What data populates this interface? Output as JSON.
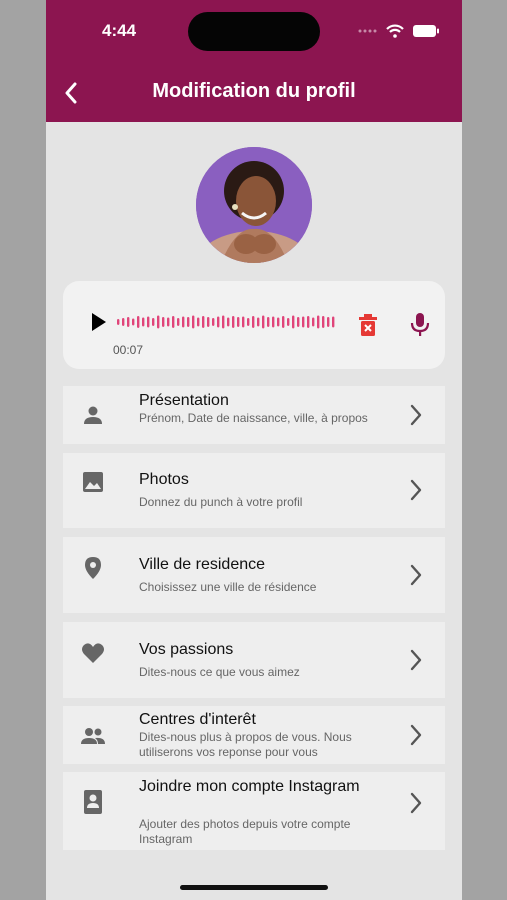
{
  "status_bar": {
    "time": "4:44"
  },
  "header": {
    "title": "Modification du profil"
  },
  "audio": {
    "duration": "00:07"
  },
  "menu": [
    {
      "icon": "person-icon",
      "title": "Présentation",
      "subtitle": "Prénom, Date de naissance, ville, à propos"
    },
    {
      "icon": "image-icon",
      "title": "Photos",
      "subtitle": "Donnez du punch à votre profil"
    },
    {
      "icon": "location-pin-icon",
      "title": "Ville de residence",
      "subtitle": "Choisissez une ville de résidence"
    },
    {
      "icon": "heart-icon",
      "title": "Vos passions",
      "subtitle": "Dites-nous ce que vous aimez"
    },
    {
      "icon": "group-icon",
      "title": "Centres d'interêt",
      "subtitle": "Dites-nous plus à propos de vous. Nous utiliserons vos reponse pour vous"
    },
    {
      "icon": "contact-card-icon",
      "title": "Joindre mon compte Instagram",
      "subtitle": "Ajouter des photos depuis votre compte Instagram"
    }
  ],
  "colors": {
    "primary": "#8c1550",
    "wave": "#e0457a",
    "delete": "#e53935",
    "background": "#e4e4e4"
  }
}
